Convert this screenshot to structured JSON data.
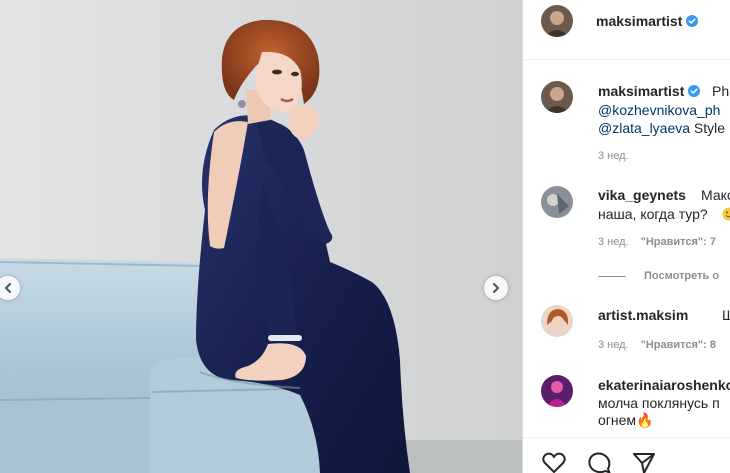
{
  "post": {
    "author": "maksimartist",
    "verified": true
  },
  "caption": {
    "username": "maksimartist",
    "line1": "Ph",
    "mention1": "@kozhevnikova_ph",
    "mention2": "@zlata_lyaeva",
    "line3_rest": " Style",
    "time": "3 нед."
  },
  "comments": [
    {
      "username": "vika_geynets",
      "text_line1": "Макс",
      "text_line2": "наша, когда тур?",
      "time": "3 нед.",
      "likes": "\"Нравится\": 7"
    },
    {
      "username": "artist.maksim",
      "text_line1": "Шик",
      "time": "3 нед.",
      "likes": "\"Нравится\": 8"
    },
    {
      "username": "ekaterinaiaroshenko",
      "text_line1": "молча поклянусь п",
      "text_line2": "огнем🔥"
    }
  ],
  "view_replies": "Посмотреть о",
  "icons": {
    "like": "heart-icon",
    "comment": "comment-icon",
    "share": "send-icon",
    "verified": "verified-badge-icon",
    "prev": "chevron-left-icon",
    "next": "chevron-right-icon"
  },
  "colors": {
    "dress": "#1b2556",
    "sofa": "#b9d1df",
    "link": "#00376b",
    "verified": "#3897f0"
  }
}
